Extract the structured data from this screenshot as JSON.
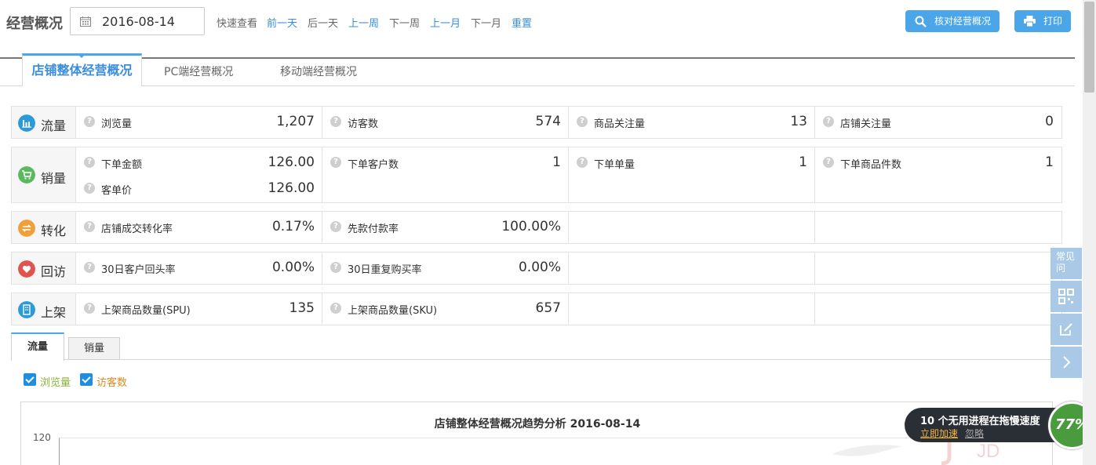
{
  "header": {
    "title": "经营概况",
    "date": "2016-08-14",
    "quick_label": "快速查看",
    "quick_links": [
      "前一天",
      "后一天",
      "上一周",
      "下一周",
      "上一月",
      "下一月",
      "重置"
    ],
    "verify_button": "核对经营概况",
    "print_button": "打印"
  },
  "tabs": [
    "店铺整体经营概况",
    "PC端经营概况",
    "移动端经营概况"
  ],
  "metrics": {
    "traffic": {
      "label": "流量",
      "items": [
        {
          "label": "浏览量",
          "value": "1,207"
        },
        {
          "label": "访客数",
          "value": "574"
        },
        {
          "label": "商品关注量",
          "value": "13"
        },
        {
          "label": "店铺关注量",
          "value": "0"
        }
      ]
    },
    "sales": {
      "label": "销量",
      "items": [
        {
          "label": "下单金额",
          "value": "126.00"
        },
        {
          "label": "客单价",
          "value": "126.00"
        },
        {
          "label": "下单客户数",
          "value": "1"
        },
        {
          "label": "下单单量",
          "value": "1"
        },
        {
          "label": "下单商品件数",
          "value": "1"
        }
      ]
    },
    "conversion": {
      "label": "转化",
      "items": [
        {
          "label": "店铺成交转化率",
          "value": "0.17%"
        },
        {
          "label": "先款付款率",
          "value": "100.00%"
        }
      ]
    },
    "revisit": {
      "label": "回访",
      "items": [
        {
          "label": "30日客户回头率",
          "value": "0.00%"
        },
        {
          "label": "30日重复购买率",
          "value": "0.00%"
        }
      ]
    },
    "listing": {
      "label": "上架",
      "items": [
        {
          "label": "上架商品数量(SPU)",
          "value": "135"
        },
        {
          "label": "上架商品数量(SKU)",
          "value": "657"
        }
      ]
    }
  },
  "chart_section": {
    "tabs": [
      "流量",
      "销量"
    ],
    "checkboxes": [
      {
        "label": "浏览量",
        "color": "#8db33a",
        "checked": true
      },
      {
        "label": "访客数",
        "color": "#e08a1e",
        "checked": true
      }
    ],
    "chart_title": "店铺整体经营概况趋势分析 2016-08-14",
    "y_tick_top": "120"
  },
  "side_tools": [
    "常见问"
  ],
  "popup": {
    "title": "10 个无用进程在拖慢速度",
    "action_primary": "立即加速",
    "action_secondary": "忽略",
    "gauge_value": "77%"
  },
  "colors": {
    "accent": "#4aa6e9",
    "link": "#3a8ddc",
    "traffic_icon": "#2b9ad8",
    "sales_icon": "#5cb85c",
    "conversion_icon": "#f0a03a",
    "revisit_icon": "#e0534f",
    "listing_icon": "#2b9ad8"
  }
}
